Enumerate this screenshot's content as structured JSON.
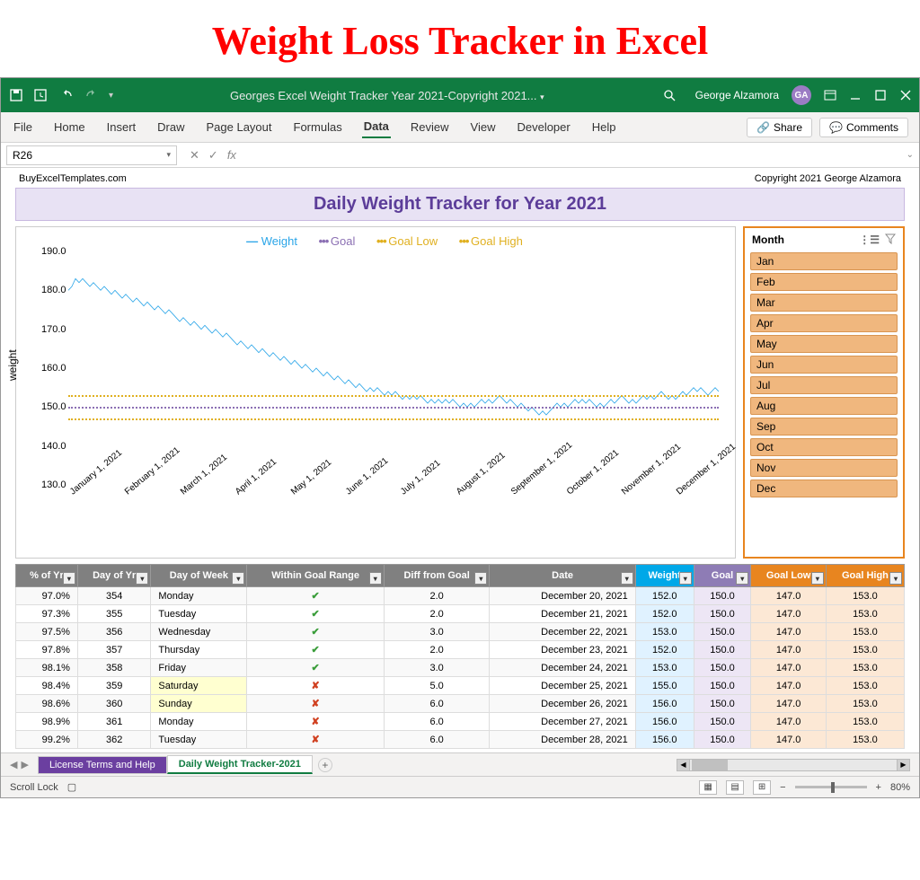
{
  "banner": "Weight Loss Tracker in Excel",
  "titlebar": {
    "title": "Georges Excel Weight Tracker Year 2021-Copyright 2021...",
    "user": "George Alzamora",
    "initials": "GA"
  },
  "ribbon": {
    "tabs": [
      "File",
      "Home",
      "Insert",
      "Draw",
      "Page Layout",
      "Formulas",
      "Data",
      "Review",
      "View",
      "Developer",
      "Help"
    ],
    "active": "Data",
    "share": "Share",
    "comments": "Comments"
  },
  "formula": {
    "namebox": "R26",
    "fx": "fx"
  },
  "sheet": {
    "vendor": "BuyExcelTemplates.com",
    "copyright": "Copyright 2021  George Alzamora",
    "title": "Daily Weight Tracker for Year 2021"
  },
  "legend": {
    "weight": "Weight",
    "goal": "Goal",
    "goal_low": "Goal Low",
    "goal_high": "Goal High"
  },
  "chart_data": {
    "type": "line",
    "ylabel": "weight",
    "ylim": [
      130,
      190
    ],
    "y_ticks": [
      "130.0",
      "140.0",
      "150.0",
      "160.0",
      "170.0",
      "180.0",
      "190.0"
    ],
    "x_labels": [
      "January 1, 2021",
      "February 1, 2021",
      "March 1, 2021",
      "April 1, 2021",
      "May 1, 2021",
      "June 1, 2021",
      "July 1, 2021",
      "August 1, 2021",
      "September 1, 2021",
      "October 1, 2021",
      "November 1, 2021",
      "December 1, 2021"
    ],
    "goal": 150.0,
    "goal_low": 147.0,
    "goal_high": 153.0,
    "series": [
      {
        "name": "Weight",
        "values": [
          180,
          181,
          183,
          182,
          183,
          182,
          181,
          182,
          181,
          180,
          181,
          180,
          179,
          180,
          179,
          178,
          179,
          178,
          177,
          178,
          177,
          176,
          177,
          176,
          175,
          176,
          175,
          174,
          175,
          174,
          173,
          172,
          173,
          172,
          171,
          172,
          171,
          170,
          171,
          170,
          169,
          170,
          169,
          168,
          169,
          168,
          167,
          166,
          167,
          166,
          165,
          166,
          165,
          164,
          165,
          164,
          163,
          164,
          163,
          162,
          163,
          162,
          161,
          162,
          161,
          160,
          161,
          160,
          159,
          160,
          159,
          158,
          159,
          158,
          157,
          158,
          157,
          156,
          157,
          156,
          155,
          156,
          155,
          154,
          155,
          154,
          155,
          154,
          153,
          154,
          153,
          154,
          153,
          152,
          153,
          152,
          153,
          152,
          153,
          152,
          151,
          152,
          151,
          152,
          151,
          152,
          151,
          152,
          151,
          150,
          151,
          150,
          151,
          150,
          151,
          152,
          151,
          152,
          151,
          152,
          153,
          152,
          151,
          152,
          151,
          150,
          151,
          150,
          149,
          150,
          149,
          148,
          149,
          148,
          149,
          150,
          151,
          150,
          151,
          150,
          151,
          152,
          151,
          152,
          151,
          152,
          151,
          150,
          151,
          150,
          151,
          152,
          151,
          152,
          153,
          152,
          151,
          152,
          151,
          152,
          153,
          152,
          153,
          152,
          153,
          154,
          153,
          152,
          153,
          152,
          153,
          154,
          153,
          154,
          155,
          154,
          155,
          154,
          153,
          154,
          155,
          154
        ]
      }
    ]
  },
  "slicer": {
    "title": "Month",
    "items": [
      "Jan",
      "Feb",
      "Mar",
      "Apr",
      "May",
      "Jun",
      "Jul",
      "Aug",
      "Sep",
      "Oct",
      "Nov",
      "Dec"
    ]
  },
  "table": {
    "headers": [
      "% of Yr",
      "Day of Yr",
      "Day of Week",
      "Within Goal Range",
      "Diff from Goal",
      "Date",
      "Weight",
      "Goal",
      "Goal Low",
      "Goal High"
    ],
    "rows": [
      {
        "pct": "97.0%",
        "doy": "354",
        "dow": "Monday",
        "ok": true,
        "diff": "2.0",
        "date": "December 20, 2021",
        "w": "152.0",
        "g": "150.0",
        "gl": "147.0",
        "gh": "153.0",
        "we": false
      },
      {
        "pct": "97.3%",
        "doy": "355",
        "dow": "Tuesday",
        "ok": true,
        "diff": "2.0",
        "date": "December 21, 2021",
        "w": "152.0",
        "g": "150.0",
        "gl": "147.0",
        "gh": "153.0",
        "we": false
      },
      {
        "pct": "97.5%",
        "doy": "356",
        "dow": "Wednesday",
        "ok": true,
        "diff": "3.0",
        "date": "December 22, 2021",
        "w": "153.0",
        "g": "150.0",
        "gl": "147.0",
        "gh": "153.0",
        "we": false
      },
      {
        "pct": "97.8%",
        "doy": "357",
        "dow": "Thursday",
        "ok": true,
        "diff": "2.0",
        "date": "December 23, 2021",
        "w": "152.0",
        "g": "150.0",
        "gl": "147.0",
        "gh": "153.0",
        "we": false
      },
      {
        "pct": "98.1%",
        "doy": "358",
        "dow": "Friday",
        "ok": true,
        "diff": "3.0",
        "date": "December 24, 2021",
        "w": "153.0",
        "g": "150.0",
        "gl": "147.0",
        "gh": "153.0",
        "we": false
      },
      {
        "pct": "98.4%",
        "doy": "359",
        "dow": "Saturday",
        "ok": false,
        "diff": "5.0",
        "date": "December 25, 2021",
        "w": "155.0",
        "g": "150.0",
        "gl": "147.0",
        "gh": "153.0",
        "we": true
      },
      {
        "pct": "98.6%",
        "doy": "360",
        "dow": "Sunday",
        "ok": false,
        "diff": "6.0",
        "date": "December 26, 2021",
        "w": "156.0",
        "g": "150.0",
        "gl": "147.0",
        "gh": "153.0",
        "we": true
      },
      {
        "pct": "98.9%",
        "doy": "361",
        "dow": "Monday",
        "ok": false,
        "diff": "6.0",
        "date": "December 27, 2021",
        "w": "156.0",
        "g": "150.0",
        "gl": "147.0",
        "gh": "153.0",
        "we": false
      },
      {
        "pct": "99.2%",
        "doy": "362",
        "dow": "Tuesday",
        "ok": false,
        "diff": "6.0",
        "date": "December 28, 2021",
        "w": "156.0",
        "g": "150.0",
        "gl": "147.0",
        "gh": "153.0",
        "we": false
      }
    ]
  },
  "tabs": {
    "t1": "License Terms and Help",
    "t2": "Daily Weight Tracker-2021"
  },
  "status": {
    "scroll_lock": "Scroll Lock",
    "zoom": "80%"
  }
}
